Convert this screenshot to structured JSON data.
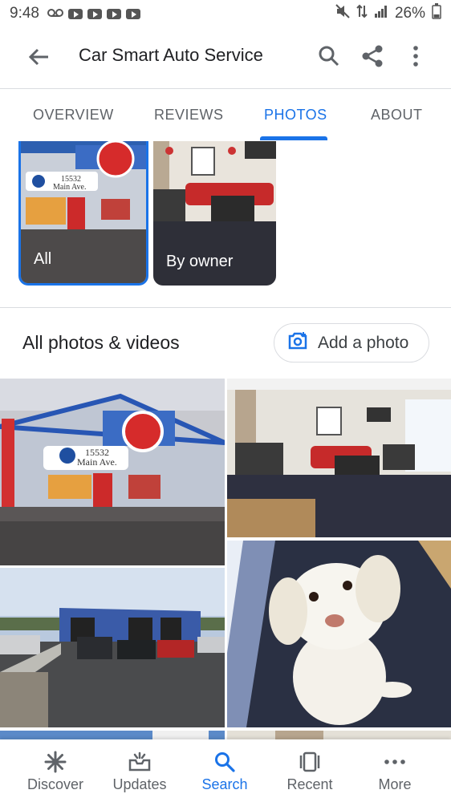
{
  "status_bar": {
    "time": "9:48",
    "battery": "26%"
  },
  "app_bar": {
    "title": "Car Smart Auto Service"
  },
  "tabs": [
    {
      "label": "OVERVIEW",
      "active": false
    },
    {
      "label": "REVIEWS",
      "active": false
    },
    {
      "label": "PHOTOS",
      "active": true
    },
    {
      "label": "ABOUT",
      "active": false
    }
  ],
  "albums": [
    {
      "label": "All",
      "selected": true
    },
    {
      "label": "By owner",
      "selected": false
    }
  ],
  "section": {
    "title": "All photos & videos",
    "add_photo_label": "Add a photo"
  },
  "bottom_nav": [
    {
      "label": "Discover",
      "icon": "asterisk-icon",
      "active": false
    },
    {
      "label": "Updates",
      "icon": "updates-tray-icon",
      "active": false
    },
    {
      "label": "Search",
      "icon": "search-icon",
      "active": true
    },
    {
      "label": "Recent",
      "icon": "recent-cards-icon",
      "active": false
    },
    {
      "label": "More",
      "icon": "more-dots-icon",
      "active": false
    }
  ],
  "colors": {
    "accent": "#1a73e8",
    "text": "#202124",
    "muted": "#5f6368"
  }
}
